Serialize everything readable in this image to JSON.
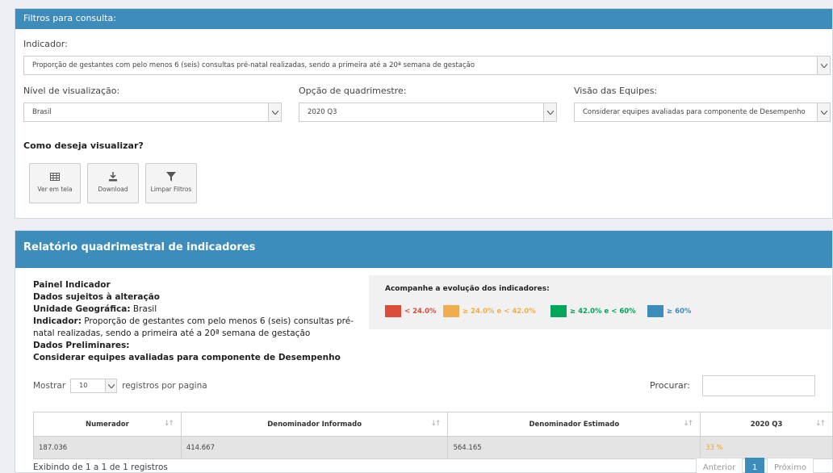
{
  "filters": {
    "header": "Filtros para consulta:",
    "indicador_label": "Indicador:",
    "indicador_value": "Proporção de gestantes com pelo menos 6 (seis) consultas pré-natal realizadas, sendo a primeira até a 20ª semana de gestação",
    "nivel_label": "Nível de visualização:",
    "nivel_value": "Brasil",
    "quadrimestre_label": "Opção de quadrimestre:",
    "quadrimestre_value": "2020 Q3",
    "visao_label": "Visão das Equipes:",
    "visao_value": "Considerar equipes avaliadas para componente de Desempenho",
    "como_label": "Como deseja visualizar?",
    "buttons": [
      {
        "label": "Ver em tela",
        "icon": "table-icon"
      },
      {
        "label": "Download",
        "icon": "download-icon"
      },
      {
        "label": "Limpar Filtros",
        "icon": "filter-icon"
      }
    ]
  },
  "report": {
    "header": "Relatório quadrimestral de indicadores",
    "painel": "Painel Indicador",
    "dados_sujeitos": "Dados sujeitos à alteração",
    "unidade_label": "Unidade Geográfica:",
    "unidade_value": "Brasil",
    "indicador_label": "Indicador:",
    "indicador_value": "Proporção de gestantes com pelo menos 6 (seis) consultas pré-natal realizadas, sendo a primeira até a 20ª semana de gestação",
    "preliminares": "Dados Preliminares:",
    "considerar": "Considerar equipes avaliadas para componente de Desempenho",
    "legend_title": "Acompanhe a evolução dos indicadores:",
    "legend": [
      {
        "label": "< 24.0%",
        "color": "#dd4b39"
      },
      {
        "label": "≥ 24.0% e < 42.0%",
        "color": "#f0ad4e"
      },
      {
        "label": "≥ 42.0% e < 60%",
        "color": "#00a65a"
      },
      {
        "label": "≥ 60%",
        "color": "#3c8dbc"
      }
    ],
    "mostrar": "Mostrar",
    "page_size": "10",
    "registros": "registros por pagina",
    "procurar": "Procurar:",
    "columns": [
      "Numerador",
      "Denominador Informado",
      "Denominador Estimado",
      "2020 Q3"
    ],
    "rows": [
      [
        "187.036",
        "414.667",
        "564.165",
        "33 %"
      ]
    ],
    "footer_info": "Exibindo de 1 a 1 de 1 registros",
    "pager": {
      "prev": "Anterior",
      "current": "1",
      "next": "Próximo"
    }
  }
}
